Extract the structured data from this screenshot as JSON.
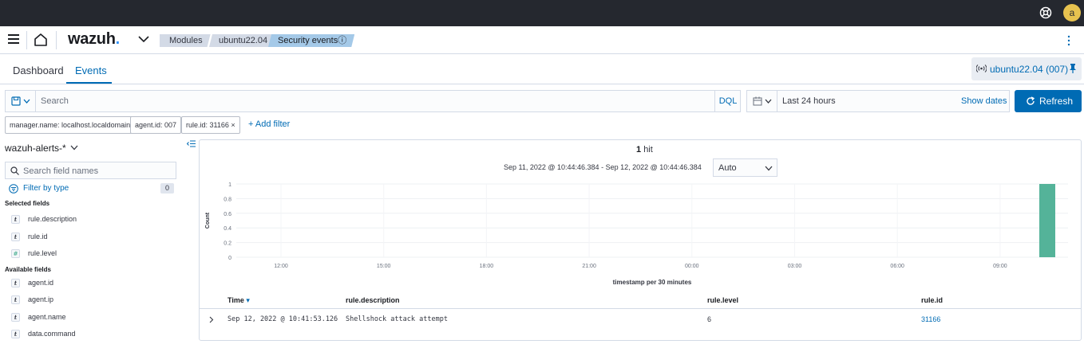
{
  "topbar": {
    "avatar_initial": "a",
    "icons": [
      "help-icon"
    ]
  },
  "navbar": {
    "logo_text": "wazuh",
    "logo_dot": ".",
    "breadcrumbs": [
      "Modules",
      "ubuntu22.04",
      "Security events"
    ],
    "breadcrumb_info_icon": "ⓘ"
  },
  "tabs": [
    {
      "label": "Dashboard",
      "active": false
    },
    {
      "label": "Events",
      "active": true
    }
  ],
  "agent_badge": {
    "label": "ubuntu22.04 (007)"
  },
  "query": {
    "placeholder": "Search",
    "language": "DQL"
  },
  "date_picker": {
    "range": "Last 24 hours",
    "show_dates": "Show dates"
  },
  "refresh": {
    "label": "Refresh"
  },
  "filters": {
    "pills": [
      "manager.name: localhost.localdomain",
      "agent.id: 007",
      "rule.id: 31166"
    ],
    "remove_icon": "×",
    "add_label": "+ Add filter"
  },
  "sidebar": {
    "index_pattern": "wazuh-alerts-*",
    "search_placeholder": "Search field names",
    "filter_by_type": "Filter by type",
    "filter_count": "0",
    "selected_title": "Selected fields",
    "selected_fields": [
      {
        "name": "rule.description",
        "type": "t"
      },
      {
        "name": "rule.id",
        "type": "t"
      },
      {
        "name": "rule.level",
        "type": "#"
      }
    ],
    "available_title": "Available fields",
    "available_fields": [
      {
        "name": "agent.id",
        "type": "t"
      },
      {
        "name": "agent.ip",
        "type": "t"
      },
      {
        "name": "agent.name",
        "type": "t"
      },
      {
        "name": "data.command",
        "type": "t"
      }
    ]
  },
  "results": {
    "hit_count": "1",
    "hit_label": "hit",
    "time_range": "Sep 11, 2022 @ 10:44:46.384 - Sep 12, 2022 @ 10:44:46.384",
    "interval": "Auto"
  },
  "chart_data": {
    "type": "bar",
    "ylabel": "Count",
    "xlabel": "timestamp per 30 minutes",
    "y_ticks": [
      "1",
      "0.8",
      "0.6",
      "0.4",
      "0.2",
      "0"
    ],
    "ylim": [
      0,
      1
    ],
    "x_ticks": [
      "12:00",
      "15:00",
      "18:00",
      "21:00",
      "00:00",
      "03:00",
      "06:00",
      "09:00"
    ],
    "bars": [
      {
        "x": "Sep 12, 2022 10:30",
        "value": 1
      }
    ],
    "bar_color": "#54b399",
    "grid": true
  },
  "table": {
    "columns": [
      "Time",
      "rule.description",
      "rule.level",
      "rule.id"
    ],
    "sort_icon": "▾",
    "rows": [
      {
        "time": "Sep 12, 2022 @ 10:41:53.126",
        "description": "Shellshock attack attempt",
        "level": "6",
        "id": "31166"
      }
    ]
  },
  "colors": {
    "accent": "#006bb4",
    "topbar": "#25282f",
    "avatar": "#e7c24f"
  }
}
